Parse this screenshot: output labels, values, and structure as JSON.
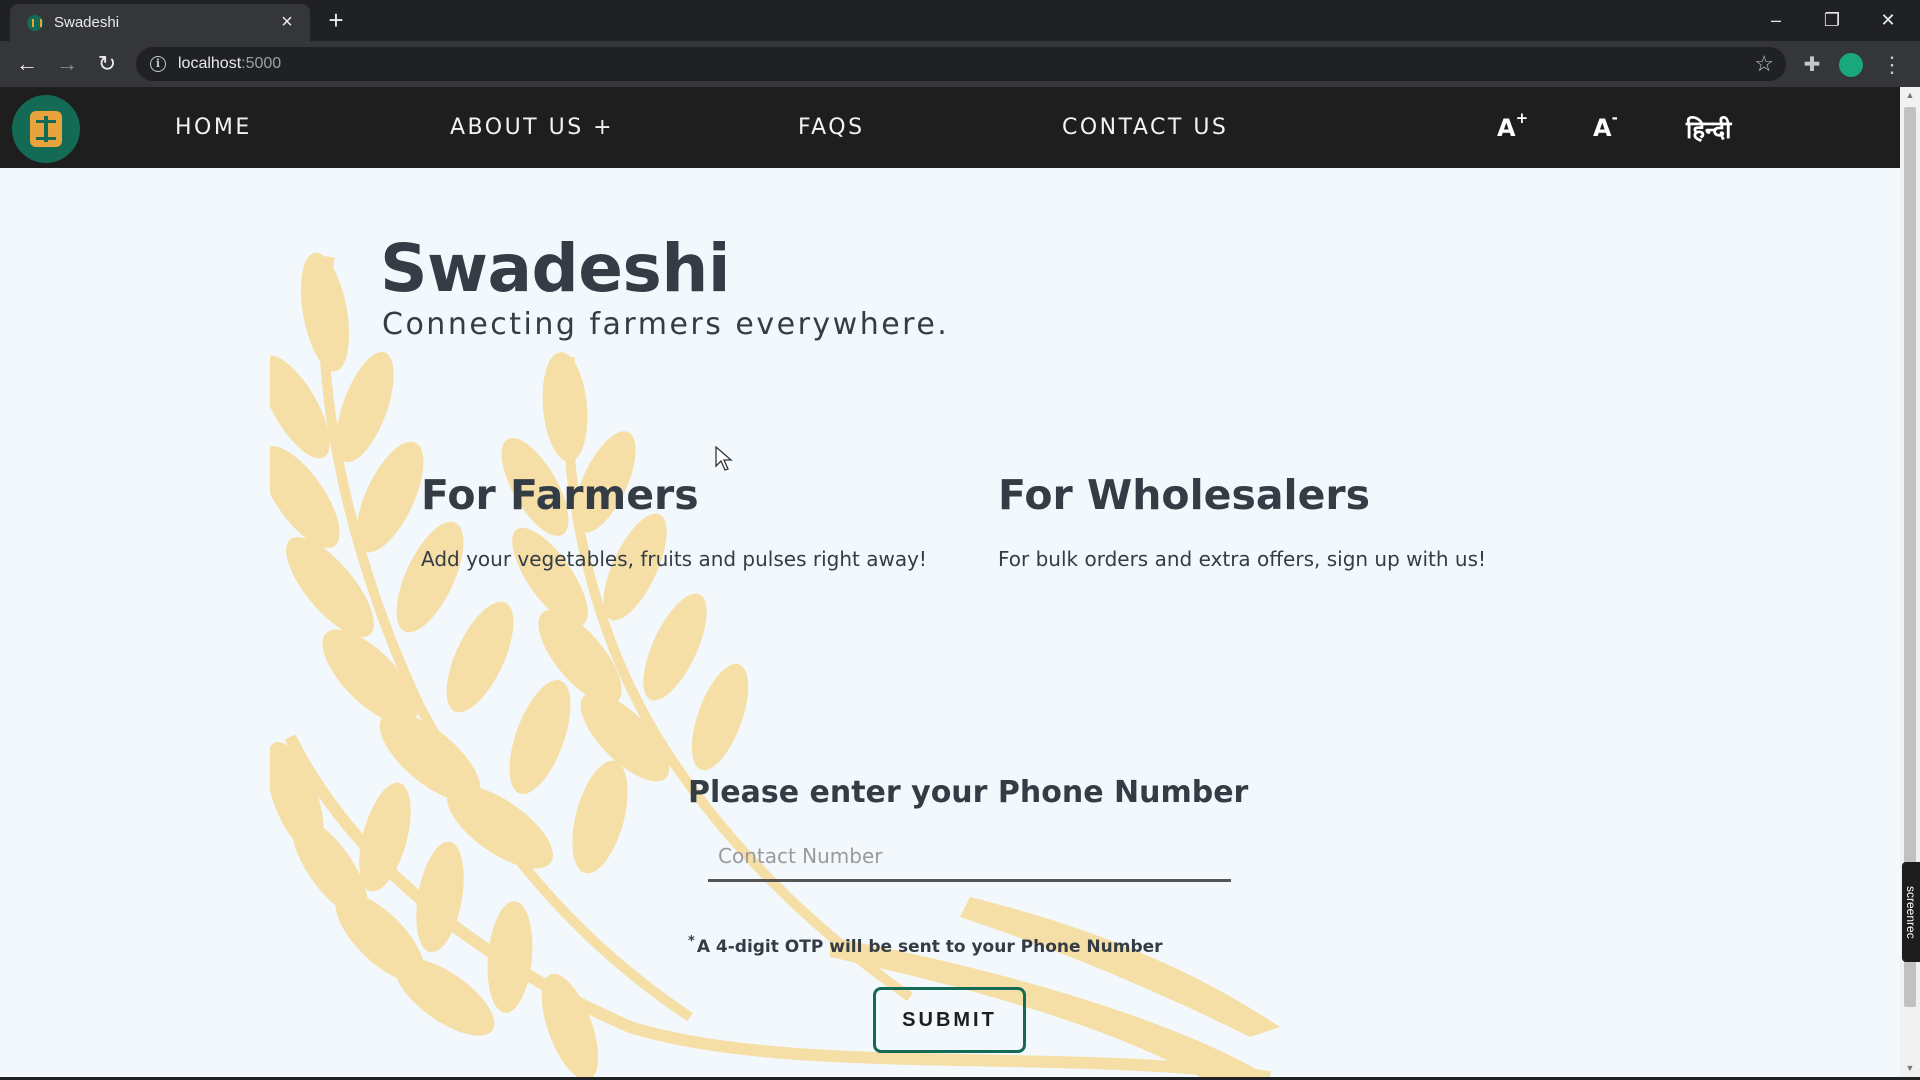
{
  "browser": {
    "tab_title": "Swadeshi",
    "url_host": "localhost",
    "url_port": ":5000"
  },
  "nav": {
    "items": [
      "HOME",
      "ABOUT US +",
      "FAQS",
      "CONTACT US"
    ],
    "font_increase": "A",
    "font_increase_sup": "+",
    "font_decrease": "A",
    "font_decrease_sup": "-",
    "language": "हिन्दी"
  },
  "hero": {
    "title": "Swadeshi",
    "subtitle": "Connecting farmers everywhere."
  },
  "cards": [
    {
      "title": "For Farmers",
      "text": "Add your vegetables, fruits and pulses right away!"
    },
    {
      "title": "For Wholesalers",
      "text": "For bulk orders and extra offers, sign up with us!"
    }
  ],
  "form": {
    "heading": "Please enter your Phone Number",
    "placeholder": "Contact Number",
    "value": "",
    "note_marker": "*",
    "note": "A 4-digit OTP will be sent to your Phone Number",
    "submit_label": "SUBMIT"
  },
  "overlay": {
    "recorder_label": "screenrec"
  },
  "colors": {
    "brand_green": "#136a55",
    "brand_orange": "#e8a33d",
    "nav_bg": "#1e1e1e",
    "page_bg": "#f3f8fc",
    "wheat": "#f6dfa6",
    "text": "#343d46"
  }
}
